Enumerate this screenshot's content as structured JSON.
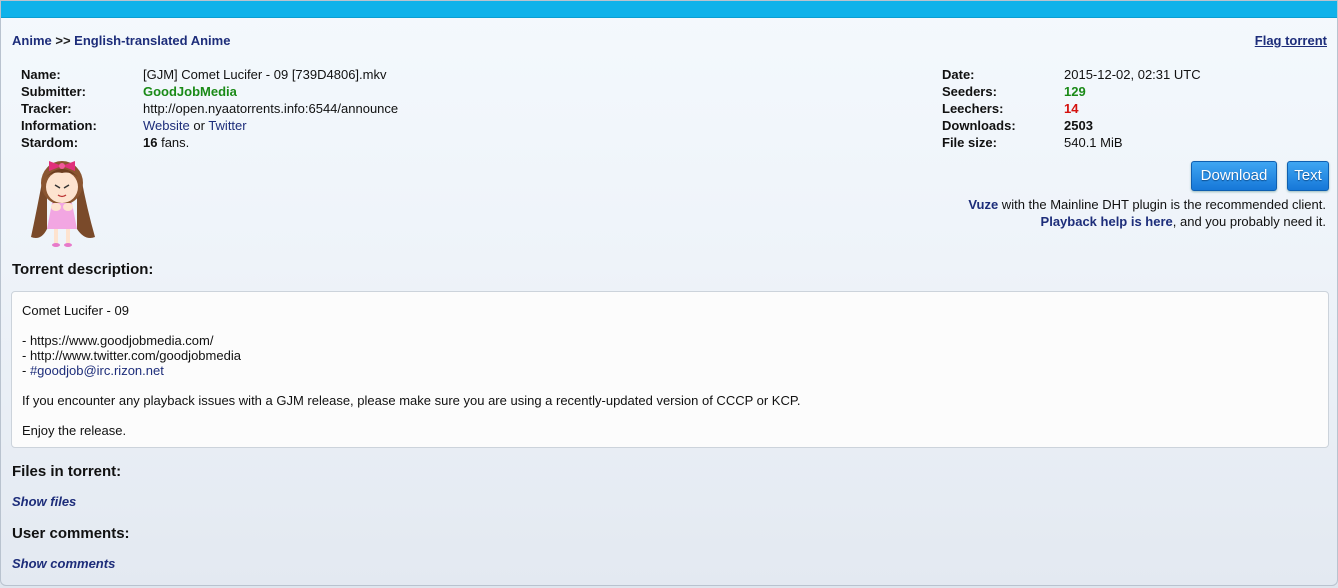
{
  "breadcrumb": {
    "category": "Anime",
    "sep": ">>",
    "subcategory": "English-translated Anime"
  },
  "flag_label": "Flag torrent",
  "left": {
    "name": {
      "label": "Name:",
      "value": "[GJM] Comet Lucifer - 09 [739D4806].mkv"
    },
    "submitter": {
      "label": "Submitter:",
      "value": "GoodJobMedia"
    },
    "tracker": {
      "label": "Tracker:",
      "value": "http://open.nyaatorrents.info:6544/announce"
    },
    "information": {
      "label": "Information:",
      "website": "Website",
      "or": "or",
      "twitter": "Twitter"
    },
    "stardom": {
      "label": "Stardom:",
      "count": "16",
      "suffix": "fans."
    }
  },
  "right": {
    "date": {
      "label": "Date:",
      "value": "2015-12-02, 02:31 UTC"
    },
    "seeders": {
      "label": "Seeders:",
      "value": "129"
    },
    "leechers": {
      "label": "Leechers:",
      "value": "14"
    },
    "downloads": {
      "label": "Downloads:",
      "value": "2503"
    },
    "filesize": {
      "label": "File size:",
      "value": "540.1 MiB"
    }
  },
  "buttons": {
    "download": "Download",
    "text": "Text"
  },
  "client": {
    "vuze": "Vuze",
    "vuze_rest": " with the Mainline DHT plugin is the recommended client.",
    "help": "Playback help is here",
    "help_rest": ", and you probably need it."
  },
  "sections": {
    "description": "Torrent description:",
    "files": "Files in torrent:",
    "show_files": "Show files",
    "comments": "User comments:",
    "show_comments": "Show comments"
  },
  "description": {
    "l1": "Comet Lucifer - 09",
    "l2": "- https://www.goodjobmedia.com/",
    "l3": "- http://www.twitter.com/goodjobmedia",
    "l4_prefix": "- ",
    "l4_link": "#goodjob@irc.rizon.net",
    "l5": "If you encounter any playback issues with a GJM release, please make sure you are using a recently-updated version of CCCP or KCP.",
    "l6": "Enjoy the release."
  },
  "colors": {
    "accent": "#0fb2ea",
    "link": "#1d2d7a",
    "seeders": "#1a8a17",
    "leechers": "#d4110e"
  }
}
